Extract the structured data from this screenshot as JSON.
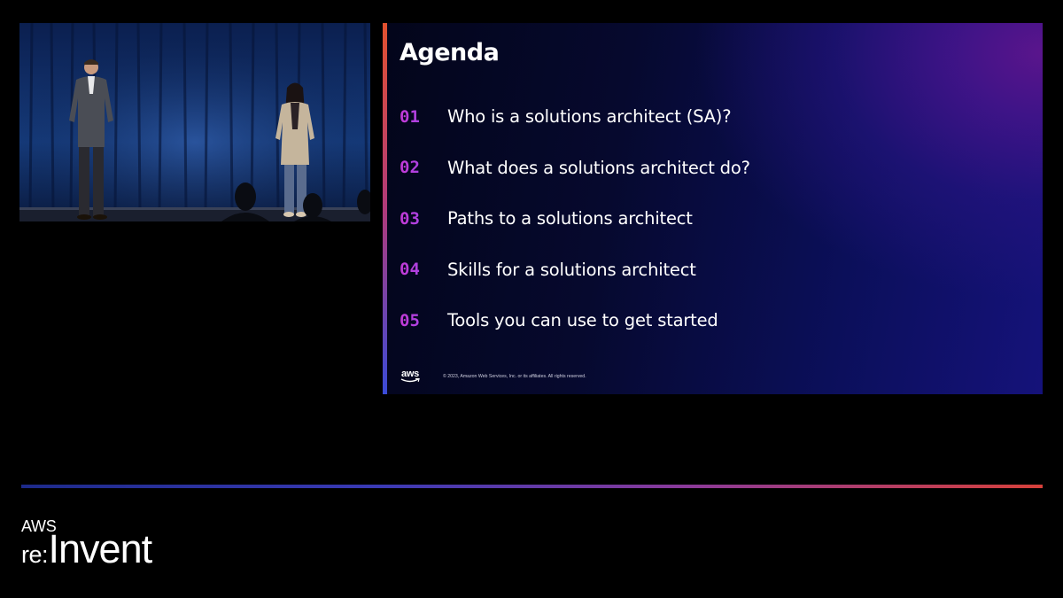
{
  "slide": {
    "title": "Agenda",
    "items": [
      {
        "number": "01",
        "text": "Who is a solutions architect (SA)?"
      },
      {
        "number": "02",
        "text": "What does a solutions architect do?"
      },
      {
        "number": "03",
        "text": "Paths to a solutions architect"
      },
      {
        "number": "04",
        "text": "Skills for a solutions architect"
      },
      {
        "number": "05",
        "text": "Tools you can use to get started"
      }
    ],
    "logo_text": "aws",
    "copyright": "© 2023, Amazon Web Services, Inc. or its affiliates. All rights reserved."
  },
  "branding": {
    "aws": "AWS",
    "re": "re",
    "colon": ":",
    "invent": "Invent"
  },
  "colors": {
    "background": "#000000",
    "slide_dark": "#06092e",
    "slide_purple": "#5a158c",
    "accent_orange": "#e2512f",
    "accent_blue": "#3a4bd8",
    "number_magenta": "#c43ad6",
    "text_white": "#ffffff"
  },
  "icons": [
    "aws-smile-logo-icon"
  ]
}
